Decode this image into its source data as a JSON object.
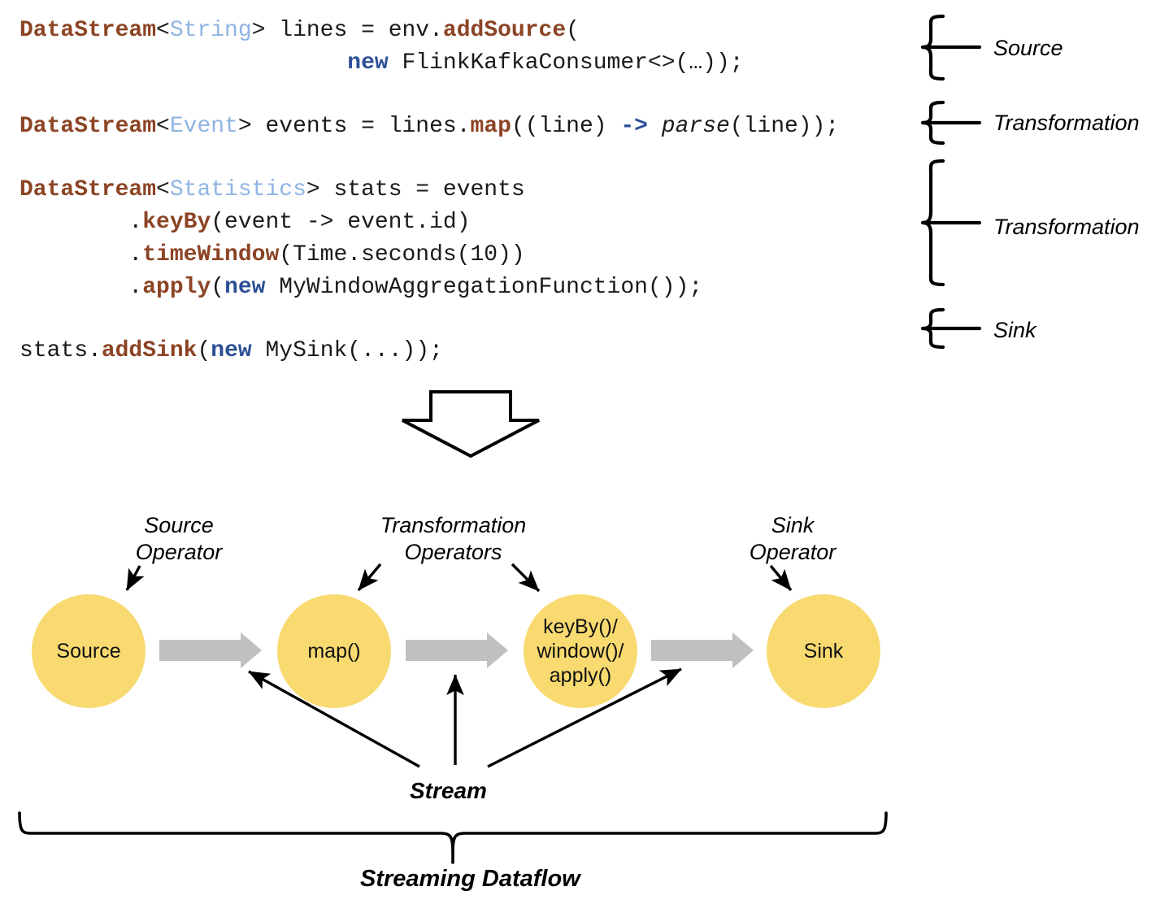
{
  "code": {
    "lines": [
      [
        {
          "t": "DataStream",
          "c": "tok-type"
        },
        {
          "t": "<",
          "c": "tok-plain"
        },
        {
          "t": "String",
          "c": "tok-generic"
        },
        {
          "t": "> lines = env.",
          "c": "tok-plain"
        },
        {
          "t": "addSource",
          "c": "tok-method"
        },
        {
          "t": "(",
          "c": "tok-plain"
        }
      ],
      [
        {
          "t": "                        ",
          "c": "tok-plain"
        },
        {
          "t": "new",
          "c": "tok-kw"
        },
        {
          "t": " FlinkKafkaConsumer<>(…));",
          "c": "tok-plain"
        }
      ],
      [],
      [
        {
          "t": "DataStream",
          "c": "tok-type"
        },
        {
          "t": "<",
          "c": "tok-plain"
        },
        {
          "t": "Event",
          "c": "tok-generic"
        },
        {
          "t": "> events = lines.",
          "c": "tok-plain"
        },
        {
          "t": "map",
          "c": "tok-method"
        },
        {
          "t": "((line) ",
          "c": "tok-plain"
        },
        {
          "t": "->",
          "c": "tok-arrow"
        },
        {
          "t": " ",
          "c": "tok-plain"
        },
        {
          "t": "parse",
          "c": "tok-italic"
        },
        {
          "t": "(line));",
          "c": "tok-plain"
        }
      ],
      [],
      [
        {
          "t": "DataStream",
          "c": "tok-type"
        },
        {
          "t": "<",
          "c": "tok-plain"
        },
        {
          "t": "Statistics",
          "c": "tok-generic"
        },
        {
          "t": "> stats = events",
          "c": "tok-plain"
        }
      ],
      [
        {
          "t": "        .",
          "c": "tok-plain"
        },
        {
          "t": "keyBy",
          "c": "tok-method"
        },
        {
          "t": "(event -> event.id)",
          "c": "tok-plain"
        }
      ],
      [
        {
          "t": "        .",
          "c": "tok-plain"
        },
        {
          "t": "timeWindow",
          "c": "tok-method"
        },
        {
          "t": "(Time.seconds(10))",
          "c": "tok-plain"
        }
      ],
      [
        {
          "t": "        .",
          "c": "tok-plain"
        },
        {
          "t": "apply",
          "c": "tok-method"
        },
        {
          "t": "(",
          "c": "tok-plain"
        },
        {
          "t": "new",
          "c": "tok-kw"
        },
        {
          "t": " MyWindowAggregationFunction());",
          "c": "tok-plain"
        }
      ],
      [],
      [
        {
          "t": "stats.",
          "c": "tok-plain"
        },
        {
          "t": "addSink",
          "c": "tok-method"
        },
        {
          "t": "(",
          "c": "tok-plain"
        },
        {
          "t": "new",
          "c": "tok-kw"
        },
        {
          "t": " MySink(...));",
          "c": "tok-plain"
        }
      ]
    ]
  },
  "brace_labels": [
    {
      "text": "Source"
    },
    {
      "text": "Transformation"
    },
    {
      "text": "Transformation"
    },
    {
      "text": "Sink"
    }
  ],
  "operator_labels": [
    {
      "line1": "Source",
      "line2": "Operator"
    },
    {
      "line1": "Transformation",
      "line2": "Operators"
    },
    {
      "line1": "Sink",
      "line2": "Operator"
    }
  ],
  "nodes": [
    {
      "label": "Source"
    },
    {
      "label": "map()"
    },
    {
      "label": "keyBy()/\nwindow()/\napply()"
    },
    {
      "label": "Sink"
    }
  ],
  "stream_label": "Stream",
  "dataflow_label": "Streaming Dataflow",
  "colors": {
    "node_fill": "#f8da70",
    "stream_arrow": "#c0c0c0",
    "keyword": "#2c4f96",
    "type": "#8c4424",
    "generic": "#8fb4e3",
    "outline": "#000000"
  }
}
